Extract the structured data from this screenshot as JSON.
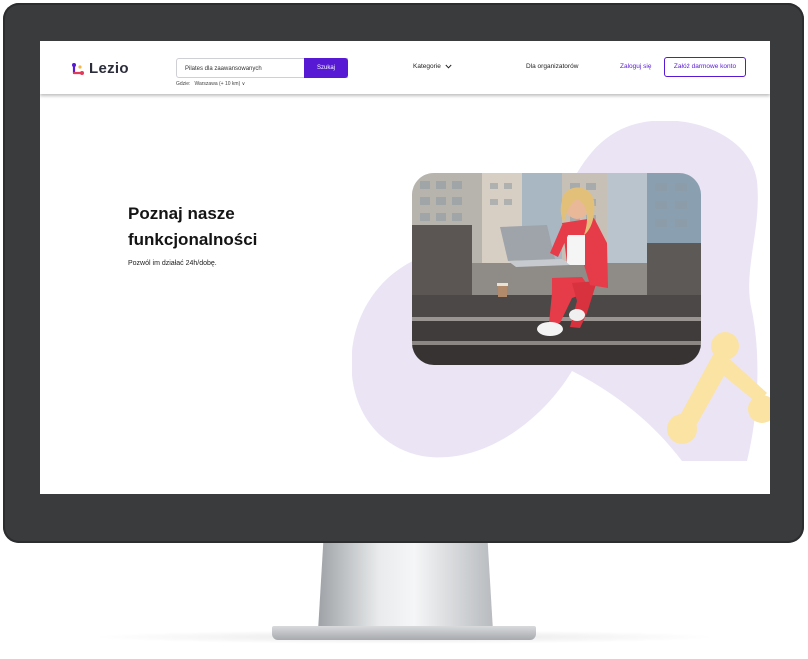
{
  "brand": {
    "name": "Lezio",
    "accent": "#5719d4",
    "blob_color": "#ebe4f5",
    "yellow": "#fbe3a4"
  },
  "header": {
    "search": {
      "value": "Pilates dla zaawansowanych",
      "button": "Szukaj"
    },
    "location": {
      "label": "Gdzie:",
      "value": "Warszawa (+ 10 km) ∨"
    },
    "nav": {
      "categories": "Kategorie",
      "organizers": "Dla organizatorów",
      "login": "Zaloguj się",
      "register": "Załóż darmowe konto"
    }
  },
  "hero": {
    "title": "Poznaj nasze funkcjonalności",
    "subtitle": "Pozwól im działać 24h/dobę.",
    "photo": "woman-in-red-suit-with-laptop-on-stairs"
  }
}
